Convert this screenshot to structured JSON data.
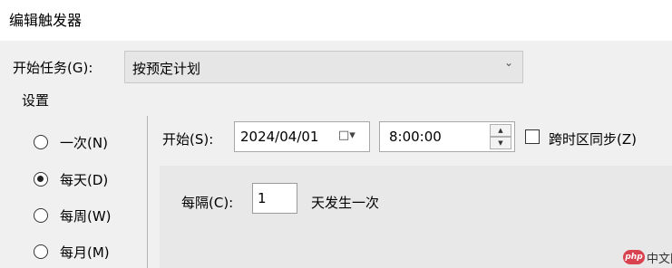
{
  "window": {
    "title": "编辑触发器"
  },
  "start_task": {
    "label": "开始任务(G):",
    "selected": "按预定计划",
    "icon": "chevron-down-icon"
  },
  "settings": {
    "group_label": "设置",
    "frequency_options": [
      {
        "label": "一次(N)",
        "checked": false
      },
      {
        "label": "每天(D)",
        "checked": true
      },
      {
        "label": "每周(W)",
        "checked": false
      },
      {
        "label": "每月(M)",
        "checked": false
      }
    ]
  },
  "start": {
    "label": "开始(S):",
    "date": "2024/04/01",
    "date_icon": "calendar-icon",
    "time": "8:00:00",
    "sync_timezone": {
      "label": "跨时区同步(Z)",
      "checked": false
    }
  },
  "recurrence": {
    "label": "每隔(C):",
    "value": "1",
    "suffix": "天发生一次"
  },
  "watermark": {
    "badge": "php",
    "text": "中文网"
  }
}
